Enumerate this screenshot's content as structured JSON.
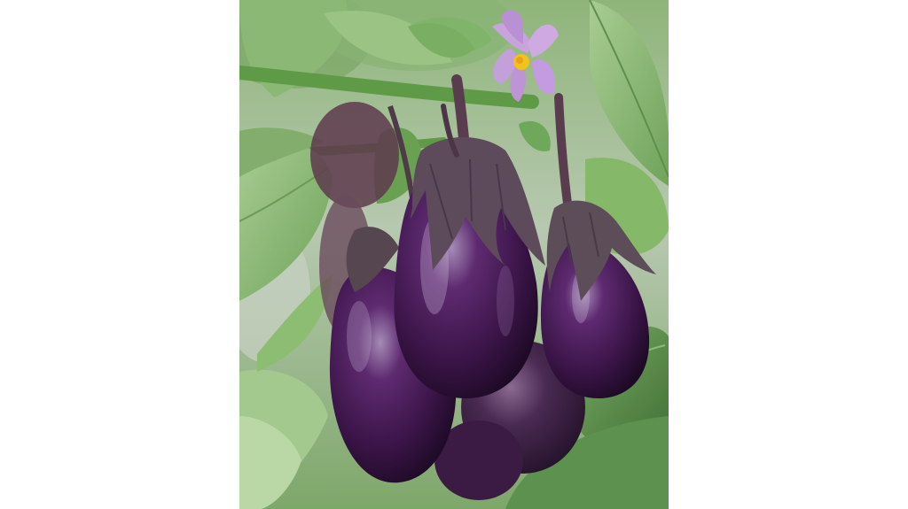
{
  "image": {
    "subject": "eggplant-plant",
    "colors": {
      "background": "#ffffff",
      "leaf_light": "#9fc489",
      "leaf_mid": "#6fa35a",
      "leaf_dark": "#3f6e34",
      "stem": "#5a8a42",
      "fruit_dark": "#2a0f33",
      "fruit_mid": "#4b1d5c",
      "fruit_highlight": "#a58bb6",
      "calyx": "#5c4a5a",
      "flower": "#c9a2dc",
      "flower_center": "#f2c21b"
    }
  }
}
